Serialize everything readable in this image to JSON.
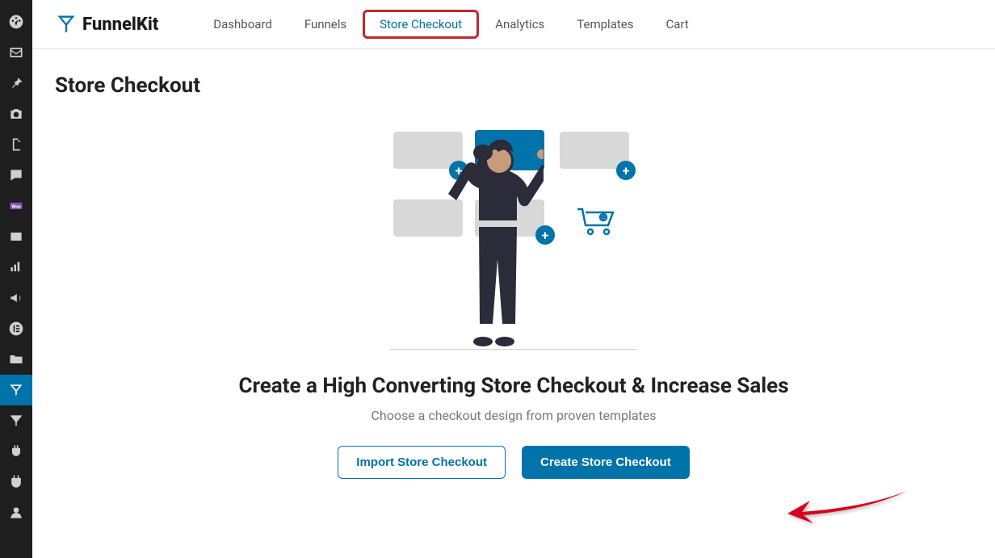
{
  "brand": {
    "name": "FunnelKit"
  },
  "wp_sidebar": {
    "items": [
      {
        "name": "dashboard-icon"
      },
      {
        "name": "mail-icon"
      },
      {
        "name": "pin-icon"
      },
      {
        "name": "camera-icon"
      },
      {
        "name": "pages-icon"
      },
      {
        "name": "comments-icon"
      },
      {
        "name": "woo-icon"
      },
      {
        "name": "card-icon"
      },
      {
        "name": "analytics-icon"
      },
      {
        "name": "marketing-icon"
      },
      {
        "name": "elementor-icon"
      },
      {
        "name": "folder-icon"
      },
      {
        "name": "funnelkit-icon"
      },
      {
        "name": "funnelkit-alt-icon"
      },
      {
        "name": "plugins-icon"
      },
      {
        "name": "plugin-alt-icon"
      },
      {
        "name": "users-icon"
      }
    ],
    "active_index": 12
  },
  "nav": {
    "tabs": [
      {
        "label": "Dashboard"
      },
      {
        "label": "Funnels"
      },
      {
        "label": "Store Checkout",
        "highlighted": true
      },
      {
        "label": "Analytics"
      },
      {
        "label": "Templates"
      },
      {
        "label": "Cart"
      }
    ]
  },
  "page": {
    "title": "Store Checkout"
  },
  "hero": {
    "title": "Create a High Converting Store Checkout & Increase Sales",
    "subtitle": "Choose a checkout design from proven templates",
    "import_btn": "Import Store Checkout",
    "create_btn": "Create Store Checkout"
  }
}
